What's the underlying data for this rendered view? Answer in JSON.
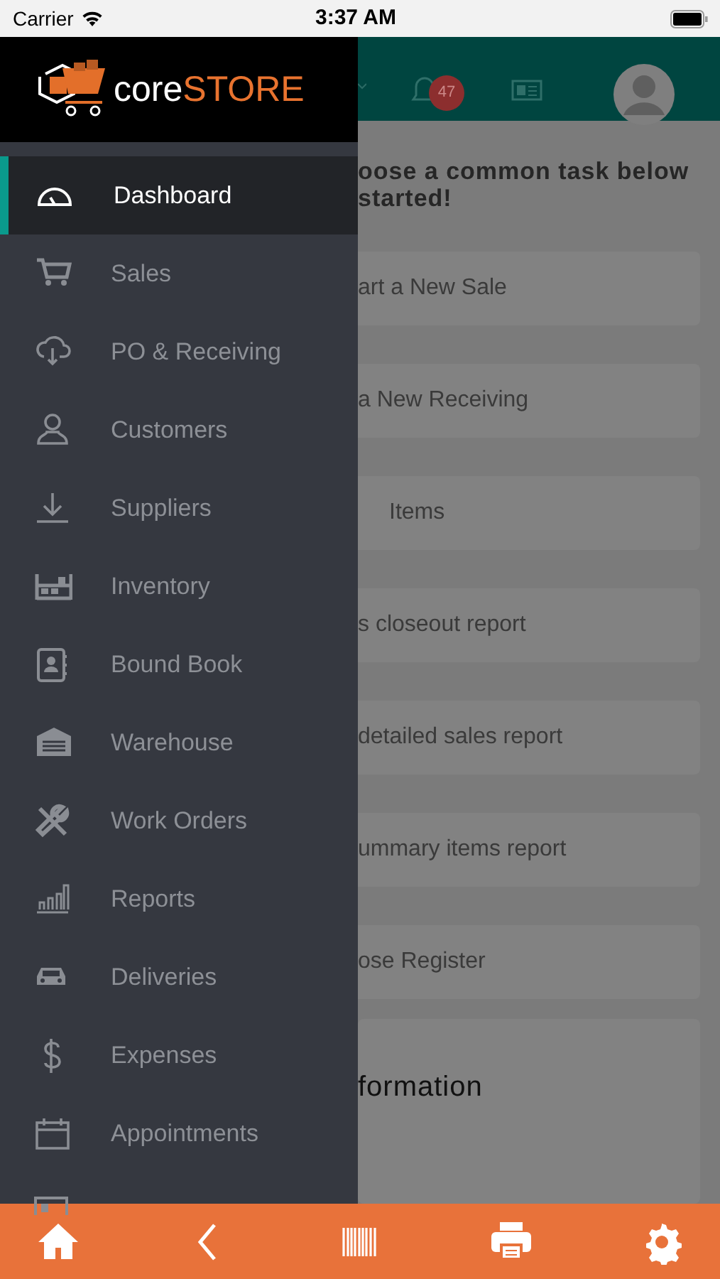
{
  "status_bar": {
    "carrier": "Carrier",
    "time": "3:37 AM"
  },
  "logo": {
    "prefix": "core",
    "suffix": "STORE"
  },
  "header": {
    "notification_count": "47"
  },
  "drawer": {
    "items": [
      {
        "label": "Dashboard",
        "kind": "dashboard",
        "selected": true
      },
      {
        "label": "Sales",
        "kind": "cart",
        "selected": false
      },
      {
        "label": "PO & Receiving",
        "kind": "cloud",
        "selected": false
      },
      {
        "label": "Customers",
        "kind": "person",
        "selected": false
      },
      {
        "label": "Suppliers",
        "kind": "download",
        "selected": false
      },
      {
        "label": "Inventory",
        "kind": "shelf",
        "selected": false
      },
      {
        "label": "Bound Book",
        "kind": "book",
        "selected": false
      },
      {
        "label": "Warehouse",
        "kind": "garage",
        "selected": false
      },
      {
        "label": "Work Orders",
        "kind": "tools",
        "selected": false
      },
      {
        "label": "Reports",
        "kind": "chart",
        "selected": false
      },
      {
        "label": "Deliveries",
        "kind": "car",
        "selected": false
      },
      {
        "label": "Expenses",
        "kind": "dollar",
        "selected": false
      },
      {
        "label": "Appointments",
        "kind": "calendar",
        "selected": false
      }
    ]
  },
  "main": {
    "prompt": [
      "oose a common task below",
      "started!"
    ],
    "tasks": [
      "art a New Sale",
      "a New Receiving",
      "Items",
      "s closeout report",
      "detailed sales report",
      "ummary items report",
      "ose Register"
    ],
    "info_title": "formation"
  },
  "tab_bar": {
    "items": [
      {
        "kind": "home"
      },
      {
        "kind": "back"
      },
      {
        "kind": "barcode"
      },
      {
        "kind": "printer"
      },
      {
        "kind": "settings"
      }
    ]
  }
}
